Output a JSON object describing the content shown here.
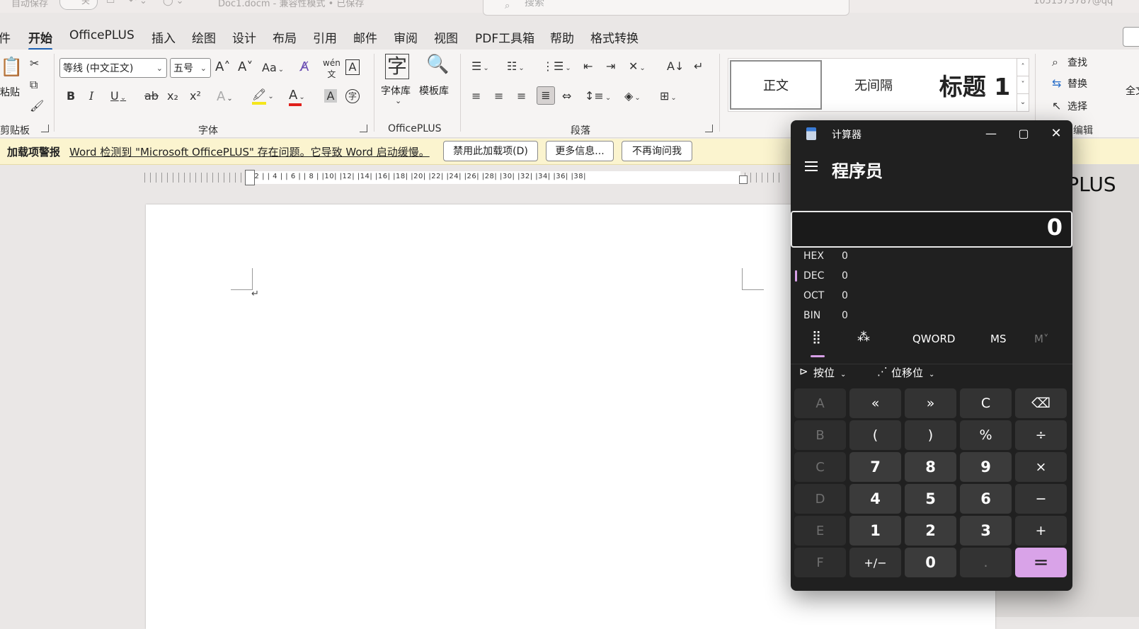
{
  "word": {
    "titlebar": {
      "autosave_label": "自动保存",
      "autosave_state": "关",
      "doc_title": "Doc1.docm  -  兼容性模式 • 已保存",
      "search_placeholder": "搜索",
      "account": "1051373787@qq"
    },
    "tabs": [
      "件",
      "开始",
      "OfficePLUS",
      "插入",
      "绘图",
      "设计",
      "布局",
      "引用",
      "邮件",
      "审阅",
      "视图",
      "PDF工具箱",
      "帮助",
      "格式转换"
    ],
    "ribbon": {
      "clipboard": {
        "paste_label": "粘贴",
        "group_label": "剪贴板"
      },
      "font": {
        "font_name": "等线 (中文正文)",
        "font_size": "五号",
        "group_label": "字体",
        "highlight_color": "#f5e61c",
        "font_color": "#e0201b"
      },
      "officeplus": {
        "font_lib": "字体库",
        "template_lib": "模板库",
        "group_label": "OfficePLUS"
      },
      "paragraph": {
        "group_label": "段落"
      },
      "styles": {
        "normal": "正文",
        "no_spacing": "无间隔",
        "heading1": "标题 1"
      },
      "editing": {
        "find": "查找",
        "replace": "替换",
        "select": "选择",
        "group_label": "编辑"
      },
      "extra": {
        "label": "全文"
      }
    },
    "warning_bar": {
      "title": "加载项警报",
      "message": "Word 检测到 \"Microsoft OfficePLUS\" 存在问题。它导致 Word 启动缓慢。",
      "disable_button": "禁用此加载项(D)",
      "more_info_button": "更多信息...",
      "dont_ask_button": "不再询问我"
    },
    "ruler_numbers": "|  2 |   | 4 |   | 6 |   | 8 |   |10|   |12|   |14|   |16|   |18|   |20|   |22|   |24|   |26|   |28|   |30|   |32|   |34|   |36|   |38|",
    "doc_heading_fragment": "ePLUS",
    "paragraph_mark": "↵"
  },
  "calculator": {
    "window_title": "计算器",
    "mode": "程序员",
    "display_value": "0",
    "bases": [
      {
        "name": "HEX",
        "value": "0"
      },
      {
        "name": "DEC",
        "value": "0",
        "selected": true
      },
      {
        "name": "OCT",
        "value": "0"
      },
      {
        "name": "BIN",
        "value": "0"
      }
    ],
    "word_size": "QWORD",
    "ms_label": "MS",
    "mlist_label": "M˅",
    "bitwise_label": "按位",
    "bitshift_label": "位移位",
    "accent_color": "#d9a3e8",
    "keys": [
      [
        "A",
        "«",
        "»",
        "C",
        "⌫"
      ],
      [
        "B",
        "(",
        ")",
        "%",
        "÷"
      ],
      [
        "C",
        "7",
        "8",
        "9",
        "×"
      ],
      [
        "D",
        "4",
        "5",
        "6",
        "−"
      ],
      [
        "E",
        "1",
        "2",
        "3",
        "+"
      ],
      [
        "F",
        "+/−",
        "0",
        ".",
        "="
      ]
    ]
  }
}
